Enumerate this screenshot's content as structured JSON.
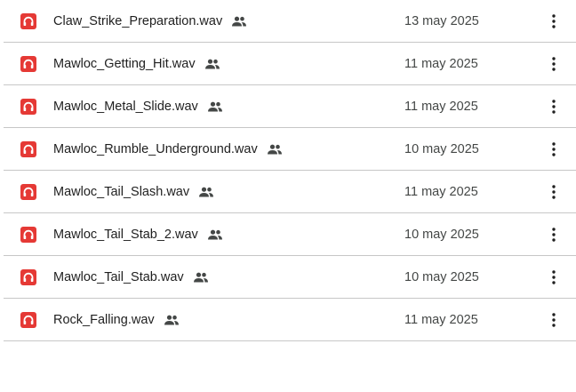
{
  "files": [
    {
      "name": "Claw_Strike_Preparation.wav",
      "date": "13 may 2025",
      "icon": "audio-file-icon",
      "shared_icon": "shared-people-icon",
      "more_icon": "more-vert-icon"
    },
    {
      "name": "Mawloc_Getting_Hit.wav",
      "date": "11 may 2025",
      "icon": "audio-file-icon",
      "shared_icon": "shared-people-icon",
      "more_icon": "more-vert-icon"
    },
    {
      "name": "Mawloc_Metal_Slide.wav",
      "date": "11 may 2025",
      "icon": "audio-file-icon",
      "shared_icon": "shared-people-icon",
      "more_icon": "more-vert-icon"
    },
    {
      "name": "Mawloc_Rumble_Underground.wav",
      "date": "10 may 2025",
      "icon": "audio-file-icon",
      "shared_icon": "shared-people-icon",
      "more_icon": "more-vert-icon"
    },
    {
      "name": "Mawloc_Tail_Slash.wav",
      "date": "11 may 2025",
      "icon": "audio-file-icon",
      "shared_icon": "shared-people-icon",
      "more_icon": "more-vert-icon"
    },
    {
      "name": "Mawloc_Tail_Stab_2.wav",
      "date": "10 may 2025",
      "icon": "audio-file-icon",
      "shared_icon": "shared-people-icon",
      "more_icon": "more-vert-icon"
    },
    {
      "name": "Mawloc_Tail_Stab.wav",
      "date": "10 may 2025",
      "icon": "audio-file-icon",
      "shared_icon": "shared-people-icon",
      "more_icon": "more-vert-icon"
    },
    {
      "name": "Rock_Falling.wav",
      "date": "11 may 2025",
      "icon": "audio-file-icon",
      "shared_icon": "shared-people-icon",
      "more_icon": "more-vert-icon"
    }
  ],
  "colors": {
    "audio_icon": "#e53935",
    "text_primary": "#1f1f1f",
    "text_secondary": "#444746",
    "divider": "#c7c7c7"
  }
}
